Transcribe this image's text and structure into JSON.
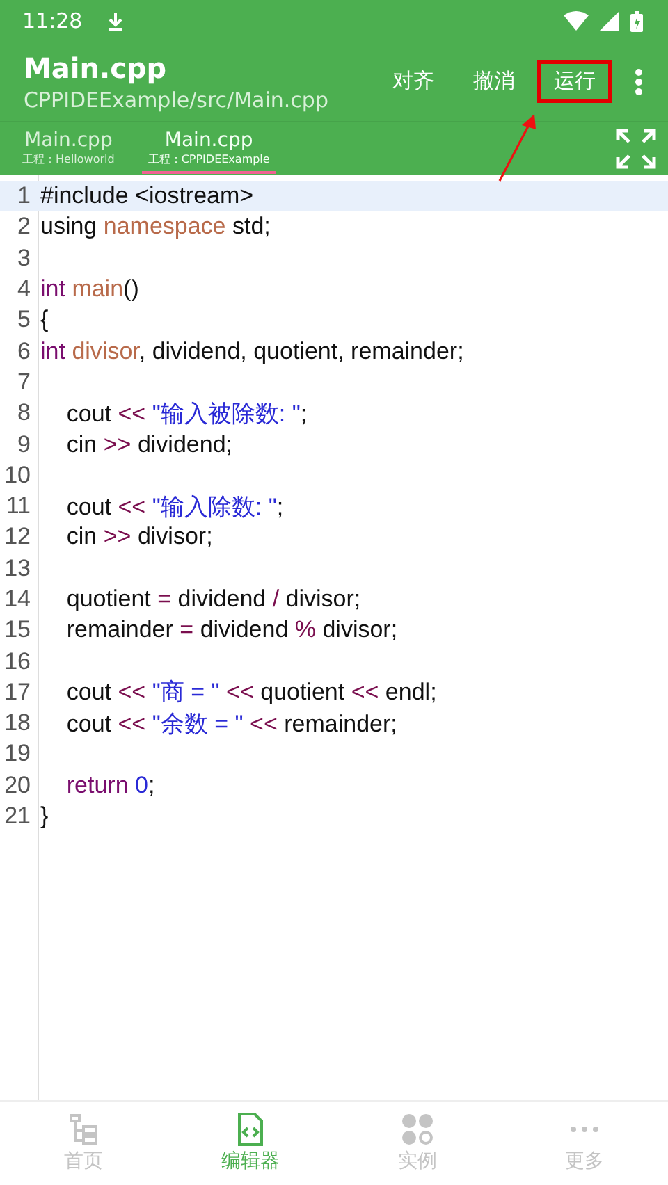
{
  "status_bar": {
    "time": "11:28"
  },
  "app_bar": {
    "title": "Main.cpp",
    "subtitle": "CPPIDEExample/src/Main.cpp",
    "actions": [
      {
        "label": "对齐",
        "highlighted": false
      },
      {
        "label": "撤消",
        "highlighted": false
      },
      {
        "label": "运行",
        "highlighted": true
      }
    ]
  },
  "tabs": [
    {
      "label": "Main.cpp",
      "project": "工程：Helloworld",
      "selected": false
    },
    {
      "label": "Main.cpp",
      "project": "工程：CPPIDEExample",
      "selected": true
    }
  ],
  "editor": {
    "lines": [
      {
        "number": "1",
        "current": true,
        "tokens": [
          {
            "kind": "plain",
            "text": "#include <iostream>"
          }
        ]
      },
      {
        "number": "2",
        "current": false,
        "tokens": [
          {
            "kind": "plain",
            "text": "using "
          },
          {
            "kind": "name",
            "text": "namespace"
          },
          {
            "kind": "plain",
            "text": " std;"
          }
        ]
      },
      {
        "number": "3",
        "current": false
      },
      {
        "number": "4",
        "current": false,
        "tokens": [
          {
            "kind": "keyword",
            "text": "int "
          },
          {
            "kind": "name",
            "text": "main"
          },
          {
            "kind": "plain",
            "text": "()"
          }
        ]
      },
      {
        "number": "5",
        "current": false,
        "tokens": [
          {
            "kind": "plain",
            "text": "{"
          }
        ]
      },
      {
        "number": "6",
        "current": false,
        "tokens": [
          {
            "kind": "keyword",
            "text": "int "
          },
          {
            "kind": "name",
            "text": "divisor"
          },
          {
            "kind": "plain",
            "text": ", dividend, quotient, remainder;"
          }
        ]
      },
      {
        "number": "7",
        "current": false
      },
      {
        "number": "8",
        "current": false,
        "tokens": [
          {
            "kind": "plain",
            "text": "    cout "
          },
          {
            "kind": "op",
            "text": "<< "
          },
          {
            "kind": "string",
            "text": "\"输入被除数: \""
          },
          {
            "kind": "plain",
            "text": ";"
          }
        ]
      },
      {
        "number": "9",
        "current": false,
        "tokens": [
          {
            "kind": "plain",
            "text": "    cin "
          },
          {
            "kind": "op",
            "text": ">>"
          },
          {
            "kind": "plain",
            "text": " dividend;"
          }
        ]
      },
      {
        "number": "10",
        "current": false
      },
      {
        "number": "11",
        "current": false,
        "tokens": [
          {
            "kind": "plain",
            "text": "    cout "
          },
          {
            "kind": "op",
            "text": "<< "
          },
          {
            "kind": "string",
            "text": "\"输入除数: \""
          },
          {
            "kind": "plain",
            "text": ";"
          }
        ]
      },
      {
        "number": "12",
        "current": false,
        "tokens": [
          {
            "kind": "plain",
            "text": "    cin "
          },
          {
            "kind": "op",
            "text": ">>"
          },
          {
            "kind": "plain",
            "text": " divisor;"
          }
        ]
      },
      {
        "number": "13",
        "current": false
      },
      {
        "number": "14",
        "current": false,
        "tokens": [
          {
            "kind": "plain",
            "text": "    quotient "
          },
          {
            "kind": "op",
            "text": "="
          },
          {
            "kind": "plain",
            "text": " dividend "
          },
          {
            "kind": "op",
            "text": "/"
          },
          {
            "kind": "plain",
            "text": " divisor;"
          }
        ]
      },
      {
        "number": "15",
        "current": false,
        "tokens": [
          {
            "kind": "plain",
            "text": "    remainder "
          },
          {
            "kind": "op",
            "text": "="
          },
          {
            "kind": "plain",
            "text": " dividend "
          },
          {
            "kind": "op",
            "text": "%"
          },
          {
            "kind": "plain",
            "text": " divisor;"
          }
        ]
      },
      {
        "number": "16",
        "current": false
      },
      {
        "number": "17",
        "current": false,
        "tokens": [
          {
            "kind": "plain",
            "text": "    cout "
          },
          {
            "kind": "op",
            "text": "<< "
          },
          {
            "kind": "string",
            "text": "\"商 = \""
          },
          {
            "kind": "op",
            "text": " <<"
          },
          {
            "kind": "plain",
            "text": " quotient "
          },
          {
            "kind": "op",
            "text": "<<"
          },
          {
            "kind": "plain",
            "text": " endl;"
          }
        ]
      },
      {
        "number": "18",
        "current": false,
        "tokens": [
          {
            "kind": "plain",
            "text": "    cout "
          },
          {
            "kind": "op",
            "text": "<< "
          },
          {
            "kind": "string",
            "text": "\"余数 = \""
          },
          {
            "kind": "op",
            "text": " <<"
          },
          {
            "kind": "plain",
            "text": " remainder;"
          }
        ]
      },
      {
        "number": "19",
        "current": false
      },
      {
        "number": "20",
        "current": false,
        "tokens": [
          {
            "kind": "keyword",
            "text": "    return "
          },
          {
            "kind": "number",
            "text": "0"
          },
          {
            "kind": "plain",
            "text": ";"
          }
        ]
      },
      {
        "number": "21",
        "current": false,
        "tokens": [
          {
            "kind": "plain",
            "text": "}"
          }
        ]
      }
    ]
  },
  "bottom_nav": [
    {
      "label": "首页",
      "selected": false
    },
    {
      "label": "编辑器",
      "selected": true
    },
    {
      "label": "实例",
      "selected": false
    },
    {
      "label": "更多",
      "selected": false
    }
  ]
}
